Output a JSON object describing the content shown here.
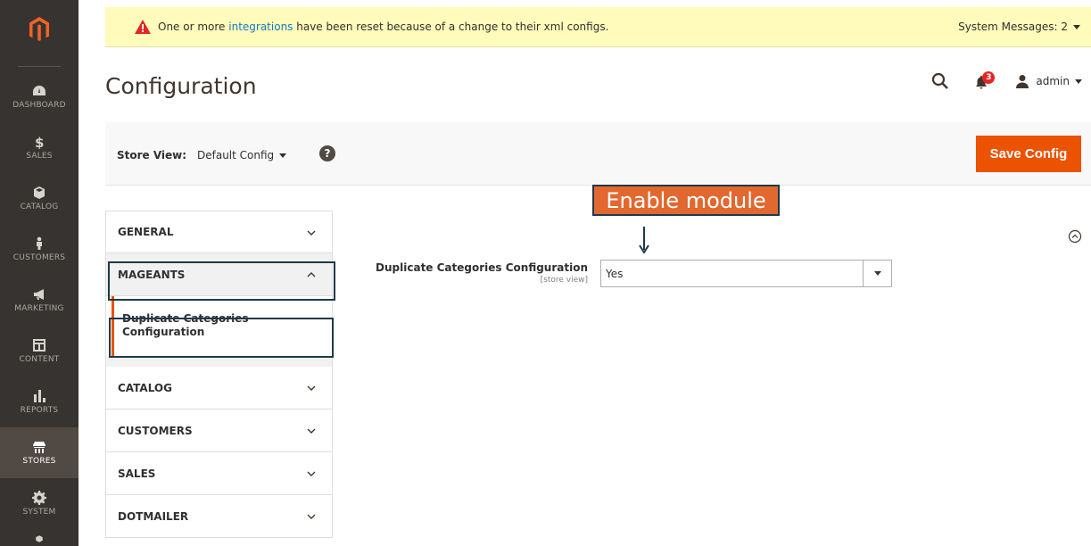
{
  "sidebar": {
    "items": [
      {
        "label": "DASHBOARD",
        "icon": "dashboard-icon"
      },
      {
        "label": "SALES",
        "icon": "dollar-icon"
      },
      {
        "label": "CATALOG",
        "icon": "box-icon"
      },
      {
        "label": "CUSTOMERS",
        "icon": "person-icon"
      },
      {
        "label": "MARKETING",
        "icon": "megaphone-icon"
      },
      {
        "label": "CONTENT",
        "icon": "layout-icon"
      },
      {
        "label": "REPORTS",
        "icon": "bar-chart-icon"
      },
      {
        "label": "STORES",
        "icon": "store-icon",
        "active": true
      },
      {
        "label": "SYSTEM",
        "icon": "gear-icon"
      }
    ]
  },
  "system_message": {
    "prefix": "One or more ",
    "link": "integrations",
    "suffix": " have been reset because of a change to their xml configs.",
    "right_label": "System Messages: 2"
  },
  "header": {
    "title": "Configuration",
    "notifications_count": "3",
    "user": "admin"
  },
  "store_bar": {
    "label": "Store View:",
    "selected": "Default Config",
    "help": "?",
    "save_label": "Save Config"
  },
  "tabs": {
    "general": "GENERAL",
    "mageants": "MAGEANTS",
    "mageants_item": "Duplicate Categories Configuration",
    "catalog": "CATALOG",
    "customers": "CUSTOMERS",
    "sales": "SALES",
    "dotmailer": "DOTMAILER"
  },
  "annotation": {
    "text": "Enable module"
  },
  "field": {
    "label": "Duplicate Categories Configuration",
    "scope": "[store view]",
    "value": "Yes"
  },
  "colors": {
    "sidebar_bg": "#373330",
    "accent": "#eb5202",
    "message_bg": "#fffbbb",
    "link": "#1979c3",
    "highlight_border": "#1e3a4a",
    "annotation_bg": "#e2682f"
  }
}
